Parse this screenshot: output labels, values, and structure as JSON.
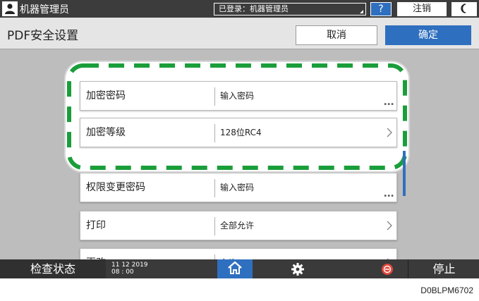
{
  "topbar": {
    "user_label": "机器管理员",
    "login_status": "已登录：机器管理员",
    "help_label": "?",
    "logout_label": "注销"
  },
  "header": {
    "title": "PDF安全设置",
    "cancel_label": "取消",
    "ok_label": "确定"
  },
  "settings": [
    {
      "label": "加密密码",
      "value": "输入密码",
      "indicator": "ellipsis"
    },
    {
      "label": "加密等级",
      "value": "128位RC4",
      "indicator": "chevron"
    },
    {
      "label": "权限变更密码",
      "value": "输入密码",
      "indicator": "ellipsis"
    },
    {
      "label": "打印",
      "value": "全部允许",
      "indicator": "chevron"
    },
    {
      "label": "更改",
      "value": "允许",
      "indicator": "chevron"
    }
  ],
  "bottombar": {
    "check_status_label": "检查状态",
    "date": "11 12 2019",
    "time": "08 : 00",
    "stop_label": "停止"
  },
  "image_code": "D0BLPM6702",
  "colors": {
    "accent_blue": "#2f6fbf",
    "highlight_dash": "#1a9e3a",
    "topbar_bg": "#3c3c3c",
    "content_bg": "#bdbdbd"
  },
  "icons": [
    "user-icon",
    "sleep-icon",
    "home-icon",
    "gear-icon",
    "stop-icon",
    "chevron-right-icon",
    "ellipsis-icon"
  ]
}
